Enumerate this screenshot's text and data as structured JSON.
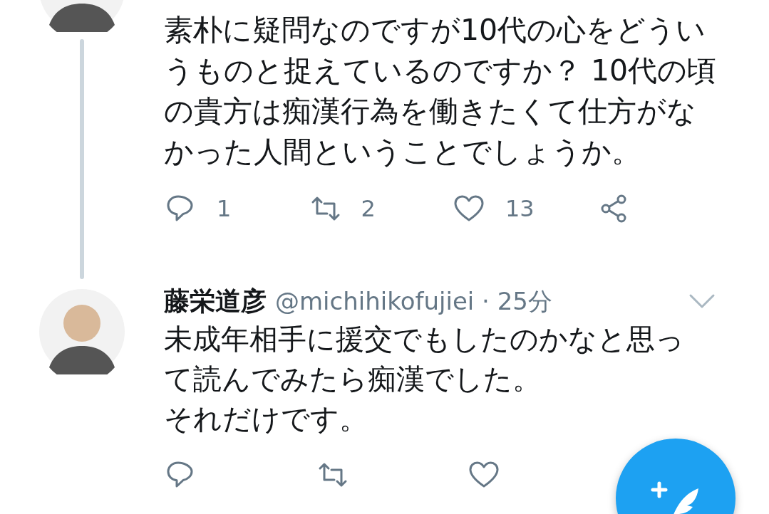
{
  "tweets": [
    {
      "thread": true,
      "text": "素朴に疑問なのですが10代の心をどういうものと捉えているのですか？ 10代の頃の貴方は痴漢行為を働きたくて仕方がなかった人間ということでしょうか。",
      "actions": [
        {
          "kind": "reply",
          "count": "1"
        },
        {
          "kind": "retweet",
          "count": "2"
        },
        {
          "kind": "like",
          "count": "13"
        },
        {
          "kind": "share"
        }
      ]
    },
    {
      "name": "藤栄道彦",
      "meta": "@michihikofujiei · 25分",
      "lines": [
        "未成年相手に援交でもしたのかなと思って読んでみたら痴漢でした。",
        "それだけです。"
      ],
      "actions": [
        {
          "kind": "reply"
        },
        {
          "kind": "retweet"
        },
        {
          "kind": "like"
        }
      ]
    }
  ]
}
